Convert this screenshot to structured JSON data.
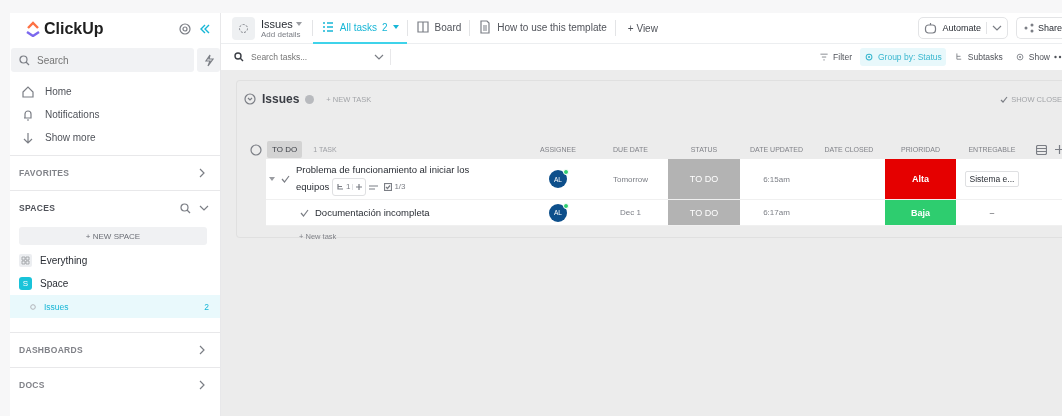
{
  "sidebar": {
    "logo": "ClickUp",
    "search": {
      "placeholder": "Search"
    },
    "nav": [
      {
        "label": "Home",
        "kind": "home"
      },
      {
        "label": "Notifications",
        "kind": "bell"
      },
      {
        "label": "Show more",
        "kind": "down"
      }
    ],
    "favorites": "FAVORITES",
    "spaces_title": "SPACES",
    "new_space": "+ NEW SPACE",
    "spaces": [
      {
        "label": "Everything",
        "kind": "everything",
        "selected": false
      },
      {
        "label": "Space",
        "kind": "space",
        "badge": "S",
        "selected": false
      },
      {
        "label": "Issues",
        "kind": "list",
        "count": "2",
        "selected": true
      }
    ],
    "sections": [
      "DASHBOARDS",
      "DOCS"
    ]
  },
  "header": {
    "title": "Issues",
    "subtitle": "Add details",
    "views": [
      {
        "label": "All tasks",
        "count": "2",
        "kind": "list",
        "selected": true
      },
      {
        "label": "Board",
        "kind": "board",
        "selected": false
      },
      {
        "label": "How to use this template",
        "kind": "doc",
        "selected": false
      }
    ],
    "add_view": "+ View",
    "automate": "Automate",
    "share": "Share"
  },
  "toolbar": {
    "search": {
      "placeholder": "Search tasks..."
    },
    "buttons": [
      {
        "label": "Filter",
        "kind": "filter",
        "selected": false
      },
      {
        "label": "Group by: Status",
        "kind": "group",
        "selected": true
      },
      {
        "label": "Subtasks",
        "kind": "subtasks",
        "selected": false
      },
      {
        "label": "Show",
        "kind": "show",
        "selected": false
      }
    ]
  },
  "list": {
    "title": "Issues",
    "new_task": "+ NEW TASK",
    "show_closed": "SHOW CLOSE",
    "group": {
      "status": "TO DO",
      "count": "1 TASK",
      "columns": [
        "ASSIGNEE",
        "DUE DATE",
        "STATUS",
        "DATE UPDATED",
        "DATE CLOSED",
        "PRIORIDAD",
        "ENTREGABLE"
      ],
      "tasks": [
        {
          "name": "Problema de funcionamiento al iniciar los equipos",
          "subtask_count": "1",
          "checklist": "1/3",
          "expanded": true,
          "assignee": "AL",
          "due": "Tomorrow",
          "status": "TO DO",
          "updated": "6:15am",
          "priority": {
            "label": "Alta",
            "color": "#e50000"
          },
          "entregable": "Sistema e...",
          "children": [
            {
              "name": "Documentación incompleta",
              "assignee": "AL",
              "due": "Dec 1",
              "status": "TO DO",
              "updated": "6:17am",
              "priority": {
                "label": "Baja",
                "color": "#2ecd6f"
              },
              "entregable": "–"
            }
          ]
        }
      ]
    },
    "new_task_row": "+ New task"
  }
}
